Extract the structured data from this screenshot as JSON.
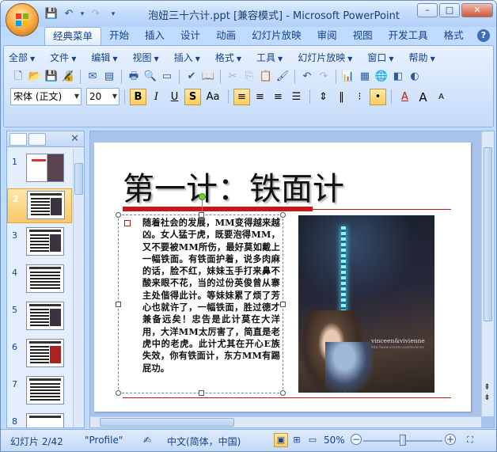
{
  "window": {
    "title": "泡妞三十六计.ppt [兼容模式] - Microsoft PowerPoint",
    "controls": [
      "–",
      "□",
      "✕"
    ]
  },
  "qat": {
    "save": "💾",
    "undo": "↶",
    "undo_dd": "▾",
    "redo": "↷",
    "more": "▾"
  },
  "ribbon_tabs": [
    "经典菜单",
    "开始",
    "插入",
    "设计",
    "动画",
    "幻灯片放映",
    "审阅",
    "视图",
    "开发工具",
    "格式"
  ],
  "help": "?",
  "menubar": [
    "全部",
    "文件",
    "编辑",
    "视图",
    "插入",
    "格式",
    "工具",
    "幻灯片放映",
    "窗口",
    "帮助"
  ],
  "toolbar": {
    "font_name": "宋体 (正文)",
    "font_size": "20",
    "bold": "B",
    "italic": "I",
    "underline": "U",
    "shadow": "S",
    "change_case": "Aa",
    "grow_font": "A",
    "shrink_font": "A"
  },
  "left_pane": {
    "close": "✕",
    "slide_numbers": [
      "1",
      "2",
      "3",
      "4",
      "5",
      "6",
      "7",
      "8"
    ],
    "selected_index": 2
  },
  "slide": {
    "title": "第一计：铁面计",
    "body": "随着社会的发展，MM变得越来越凶。女人猛于虎，既要泡得MM，又不要被MM所伤，最好莫如戴上一幅铁面。有铁面护着，说多肉麻的话，脸不红，妹妹玉手打来鼻不酸来眼不花，当的过份英俊曾从寨主处偕得此计。等妹妹累了烦了芳心也就许了，一幅铁面，胜过德才兼备远矣！忠告是此计莫在大洋用，大洋MM太厉害了，简直是老虎中的老虎。此计尤其在开心E族失效，你有铁面计，东方MM有踢屁功。",
    "photo_caption": "vinceen&vivienne",
    "photo_subcaption": "http://www.vinceen.com/vivienne"
  },
  "statusbar": {
    "slide_info": "幻灯片 2/42",
    "theme": "\"Profile\"",
    "language": "中文(简体，中国)",
    "zoom": "50%",
    "zoom_level_percent": 50
  },
  "colors": {
    "accent_red": "#c41919",
    "ribbon_blue": "#bfdbff",
    "selection_gold": "#f9c86a"
  }
}
